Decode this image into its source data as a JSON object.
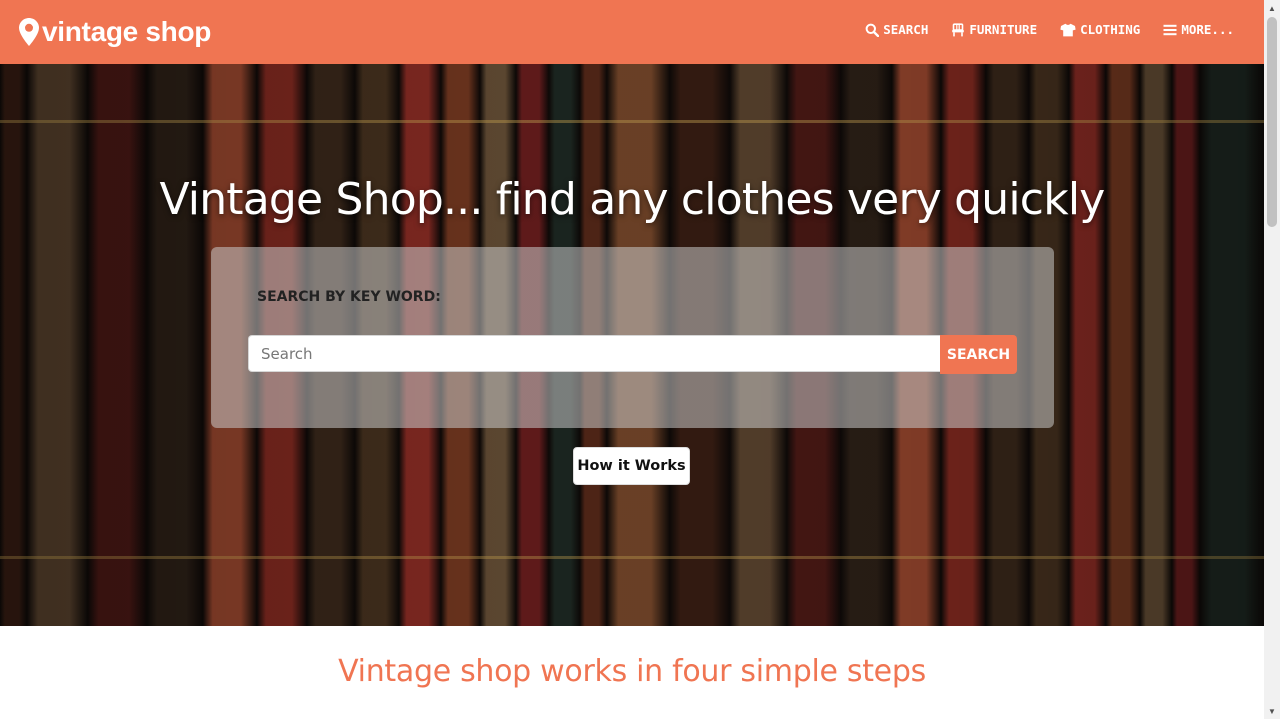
{
  "navbar": {
    "brand": "vintage shop",
    "brand_icon": "map-marker-icon",
    "items": [
      {
        "label": "SEARCH",
        "icon": "search-icon"
      },
      {
        "label": "FURNITURE",
        "icon": "chair-icon"
      },
      {
        "label": "CLOTHING",
        "icon": "tshirt-icon"
      },
      {
        "label": "MORE...",
        "icon": "menu-icon"
      }
    ]
  },
  "hero": {
    "title": "Vintage Shop... find any clothes very quickly",
    "search_label": "SEARCH BY KEY WORD:",
    "search_placeholder": "Search",
    "search_button": "SEARCH",
    "how_button": "How it Works"
  },
  "steps": {
    "heading": "Vintage shop works in four simple steps"
  },
  "colors": {
    "accent": "#f07552",
    "white": "#ffffff"
  }
}
